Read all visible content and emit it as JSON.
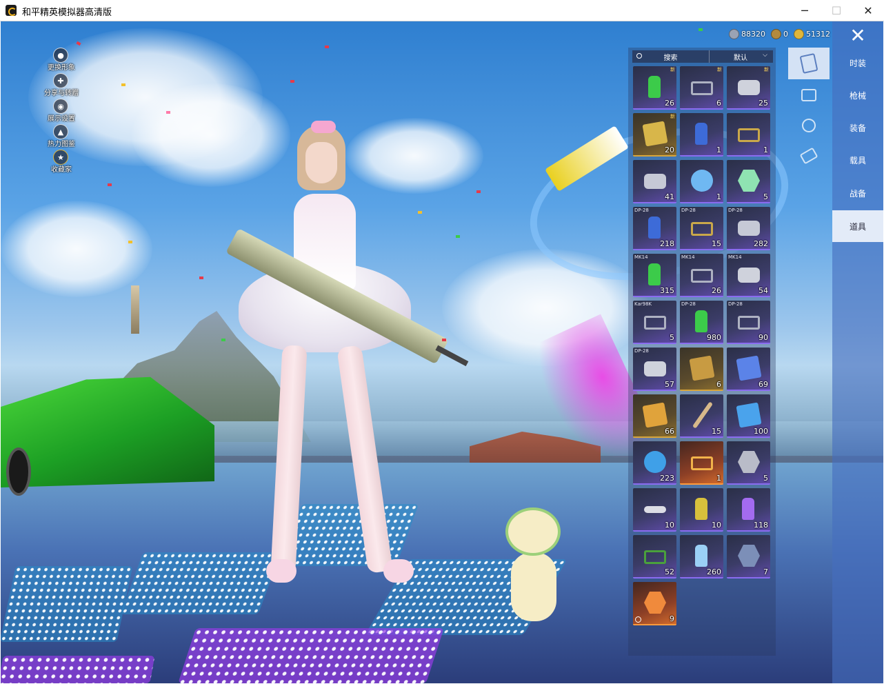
{
  "window": {
    "title": "和平精英模拟器高清版",
    "minimize": "─",
    "maximize": "☐",
    "close": "✕"
  },
  "left_menu": [
    {
      "label": "更换形象",
      "icon": "person-icon"
    },
    {
      "label": "分享与转赠",
      "icon": "share-icon"
    },
    {
      "label": "展示设置",
      "icon": "eye-icon"
    },
    {
      "label": "热力图鉴",
      "icon": "flame-icon"
    },
    {
      "label": "收藏家",
      "icon": "collector-badge-icon"
    }
  ],
  "currency": [
    {
      "value": "88320",
      "icon": "currency-silver-icon",
      "color": "#9aa3b4"
    },
    {
      "value": "0",
      "icon": "currency-bronze-icon",
      "color": "#b38a3e"
    },
    {
      "value": "51312",
      "icon": "currency-gold-icon",
      "color": "#e0b63a"
    }
  ],
  "close_label": "✕",
  "search": {
    "label": "搜索",
    "sort_label": "默认",
    "sort_chevron": "⌵"
  },
  "categories": [
    {
      "label": "时装",
      "active": false
    },
    {
      "label": "枪械",
      "active": false
    },
    {
      "label": "装备",
      "active": false
    },
    {
      "label": "载具",
      "active": false
    },
    {
      "label": "战备",
      "active": false
    },
    {
      "label": "道具",
      "active": true
    }
  ],
  "sub_tabs": [
    {
      "icon": "card-icon",
      "active": true
    },
    {
      "icon": "calendar-icon",
      "active": false
    },
    {
      "icon": "sparkle-icon",
      "active": false
    },
    {
      "icon": "ticket-icon",
      "active": false
    }
  ],
  "items": [
    {
      "count": "26",
      "gun": "",
      "badge": "新",
      "icon": "spray-can-icon",
      "color": "#3ccb4a",
      "shape": "can",
      "rarity": "purple"
    },
    {
      "count": "6",
      "gun": "",
      "badge": "新",
      "icon": "grip-box-icon",
      "color": "#aeb2c2",
      "shape": "box",
      "rarity": "purple"
    },
    {
      "count": "25",
      "gun": "",
      "badge": "新",
      "icon": "spring-icon",
      "color": "#cfd2dc",
      "shape": "spring",
      "rarity": "purple"
    },
    {
      "count": "20",
      "gun": "",
      "badge": "新",
      "icon": "warning-card-icon",
      "color": "#d8b64a",
      "shape": "card",
      "rarity": "gold"
    },
    {
      "count": "1",
      "gun": "",
      "badge": "",
      "icon": "spray-can-icon",
      "color": "#3d6bd8",
      "shape": "can",
      "rarity": "purple"
    },
    {
      "count": "1",
      "gun": "",
      "badge": "",
      "icon": "parts-box-icon",
      "color": "#c9a84a",
      "shape": "box",
      "rarity": "purple"
    },
    {
      "count": "41",
      "gun": "",
      "badge": "",
      "icon": "springs-icon",
      "color": "#c6c9d6",
      "shape": "spring",
      "rarity": "purple"
    },
    {
      "count": "1",
      "gun": "",
      "badge": "",
      "icon": "disc-icon",
      "color": "#6fb8f2",
      "shape": "disc",
      "rarity": "purple"
    },
    {
      "count": "5",
      "gun": "",
      "badge": "",
      "icon": "gadget-icon",
      "color": "#8fe3b2",
      "shape": "nut",
      "rarity": "purple"
    },
    {
      "count": "218",
      "gun": "DP-28",
      "badge": "",
      "icon": "spray-can-icon",
      "color": "#3d6bd8",
      "shape": "can",
      "rarity": "purple"
    },
    {
      "count": "15",
      "gun": "DP-28",
      "badge": "",
      "icon": "parts-box-icon",
      "color": "#c9a84a",
      "shape": "box",
      "rarity": "purple"
    },
    {
      "count": "282",
      "gun": "DP-28",
      "badge": "",
      "icon": "spring-icon",
      "color": "#c6c9d6",
      "shape": "spring",
      "rarity": "purple"
    },
    {
      "count": "315",
      "gun": "MK14",
      "badge": "",
      "icon": "spray-can-icon",
      "color": "#3ccb4a",
      "shape": "can",
      "rarity": "purple"
    },
    {
      "count": "26",
      "gun": "MK14",
      "badge": "",
      "icon": "grip-box-icon",
      "color": "#aeb2c2",
      "shape": "box",
      "rarity": "purple"
    },
    {
      "count": "54",
      "gun": "MK14",
      "badge": "",
      "icon": "spring-icon",
      "color": "#cfd2dc",
      "shape": "spring",
      "rarity": "purple"
    },
    {
      "count": "5",
      "gun": "Kar98K",
      "badge": "",
      "icon": "grip-box-icon",
      "color": "#aeb2c2",
      "shape": "box",
      "rarity": "purple"
    },
    {
      "count": "980",
      "gun": "DP-28",
      "badge": "",
      "icon": "spray-can-icon",
      "color": "#3ccb4a",
      "shape": "can",
      "rarity": "purple"
    },
    {
      "count": "90",
      "gun": "DP-28",
      "badge": "",
      "icon": "grip-box-icon",
      "color": "#aeb2c2",
      "shape": "box",
      "rarity": "purple"
    },
    {
      "count": "57",
      "gun": "DP-28",
      "badge": "",
      "icon": "spring-icon",
      "color": "#cfd2dc",
      "shape": "spring",
      "rarity": "purple"
    },
    {
      "count": "6",
      "gun": "",
      "badge": "",
      "icon": "id-card-icon",
      "color": "#c89b42",
      "shape": "card",
      "rarity": "gold"
    },
    {
      "count": "69",
      "gun": "",
      "badge": "",
      "icon": "ticket-icon",
      "color": "#5b83e8",
      "shape": "card",
      "rarity": "purple"
    },
    {
      "count": "66",
      "gun": "",
      "badge": "",
      "icon": "coupon-icon",
      "color": "#e0a33b",
      "shape": "card",
      "rarity": "gold"
    },
    {
      "count": "15",
      "gun": "",
      "badge": "",
      "icon": "stick-icon",
      "color": "#d7b98a",
      "shape": "stick",
      "rarity": "purple"
    },
    {
      "count": "100",
      "gun": "",
      "badge": "",
      "icon": "trial-ticket-icon",
      "color": "#4aa3ec",
      "shape": "card",
      "rarity": "purple"
    },
    {
      "count": "223",
      "gun": "",
      "badge": "",
      "icon": "orb-icon",
      "color": "#3fa0e8",
      "shape": "disc",
      "rarity": "purple"
    },
    {
      "count": "1",
      "gun": "",
      "badge": "",
      "icon": "medal-box-icon",
      "color": "#f2b34a",
      "shape": "box",
      "rarity": "orange"
    },
    {
      "count": "5",
      "gun": "",
      "badge": "",
      "icon": "nut-icon",
      "color": "#b9bcc8",
      "shape": "nut",
      "rarity": "purple"
    },
    {
      "count": "10",
      "gun": "",
      "badge": "",
      "icon": "key-icon",
      "color": "#dcdde5",
      "shape": "key",
      "rarity": "purple"
    },
    {
      "count": "10",
      "gun": "",
      "badge": "",
      "icon": "grenade-icon",
      "color": "#d8c03c",
      "shape": "can",
      "rarity": "purple"
    },
    {
      "count": "118",
      "gun": "",
      "badge": "",
      "icon": "spray-paint-icon",
      "color": "#a36bf0",
      "shape": "can",
      "rarity": "purple"
    },
    {
      "count": "52",
      "gun": "",
      "badge": "",
      "icon": "fuel-can-icon",
      "color": "#4aa03c",
      "shape": "box",
      "rarity": "purple"
    },
    {
      "count": "260",
      "gun": "",
      "badge": "",
      "icon": "spray-gun-icon",
      "color": "#9bd0f5",
      "shape": "can",
      "rarity": "purple"
    },
    {
      "count": "7",
      "gun": "",
      "badge": "",
      "icon": "emblem-icon",
      "color": "#7c8fb8",
      "shape": "nut",
      "rarity": "purple"
    },
    {
      "count": "9",
      "gun": "",
      "badge": "",
      "icon": "star-badge-icon",
      "color": "#f08a3c",
      "shape": "nut",
      "rarity": "orange",
      "timed": true
    }
  ]
}
